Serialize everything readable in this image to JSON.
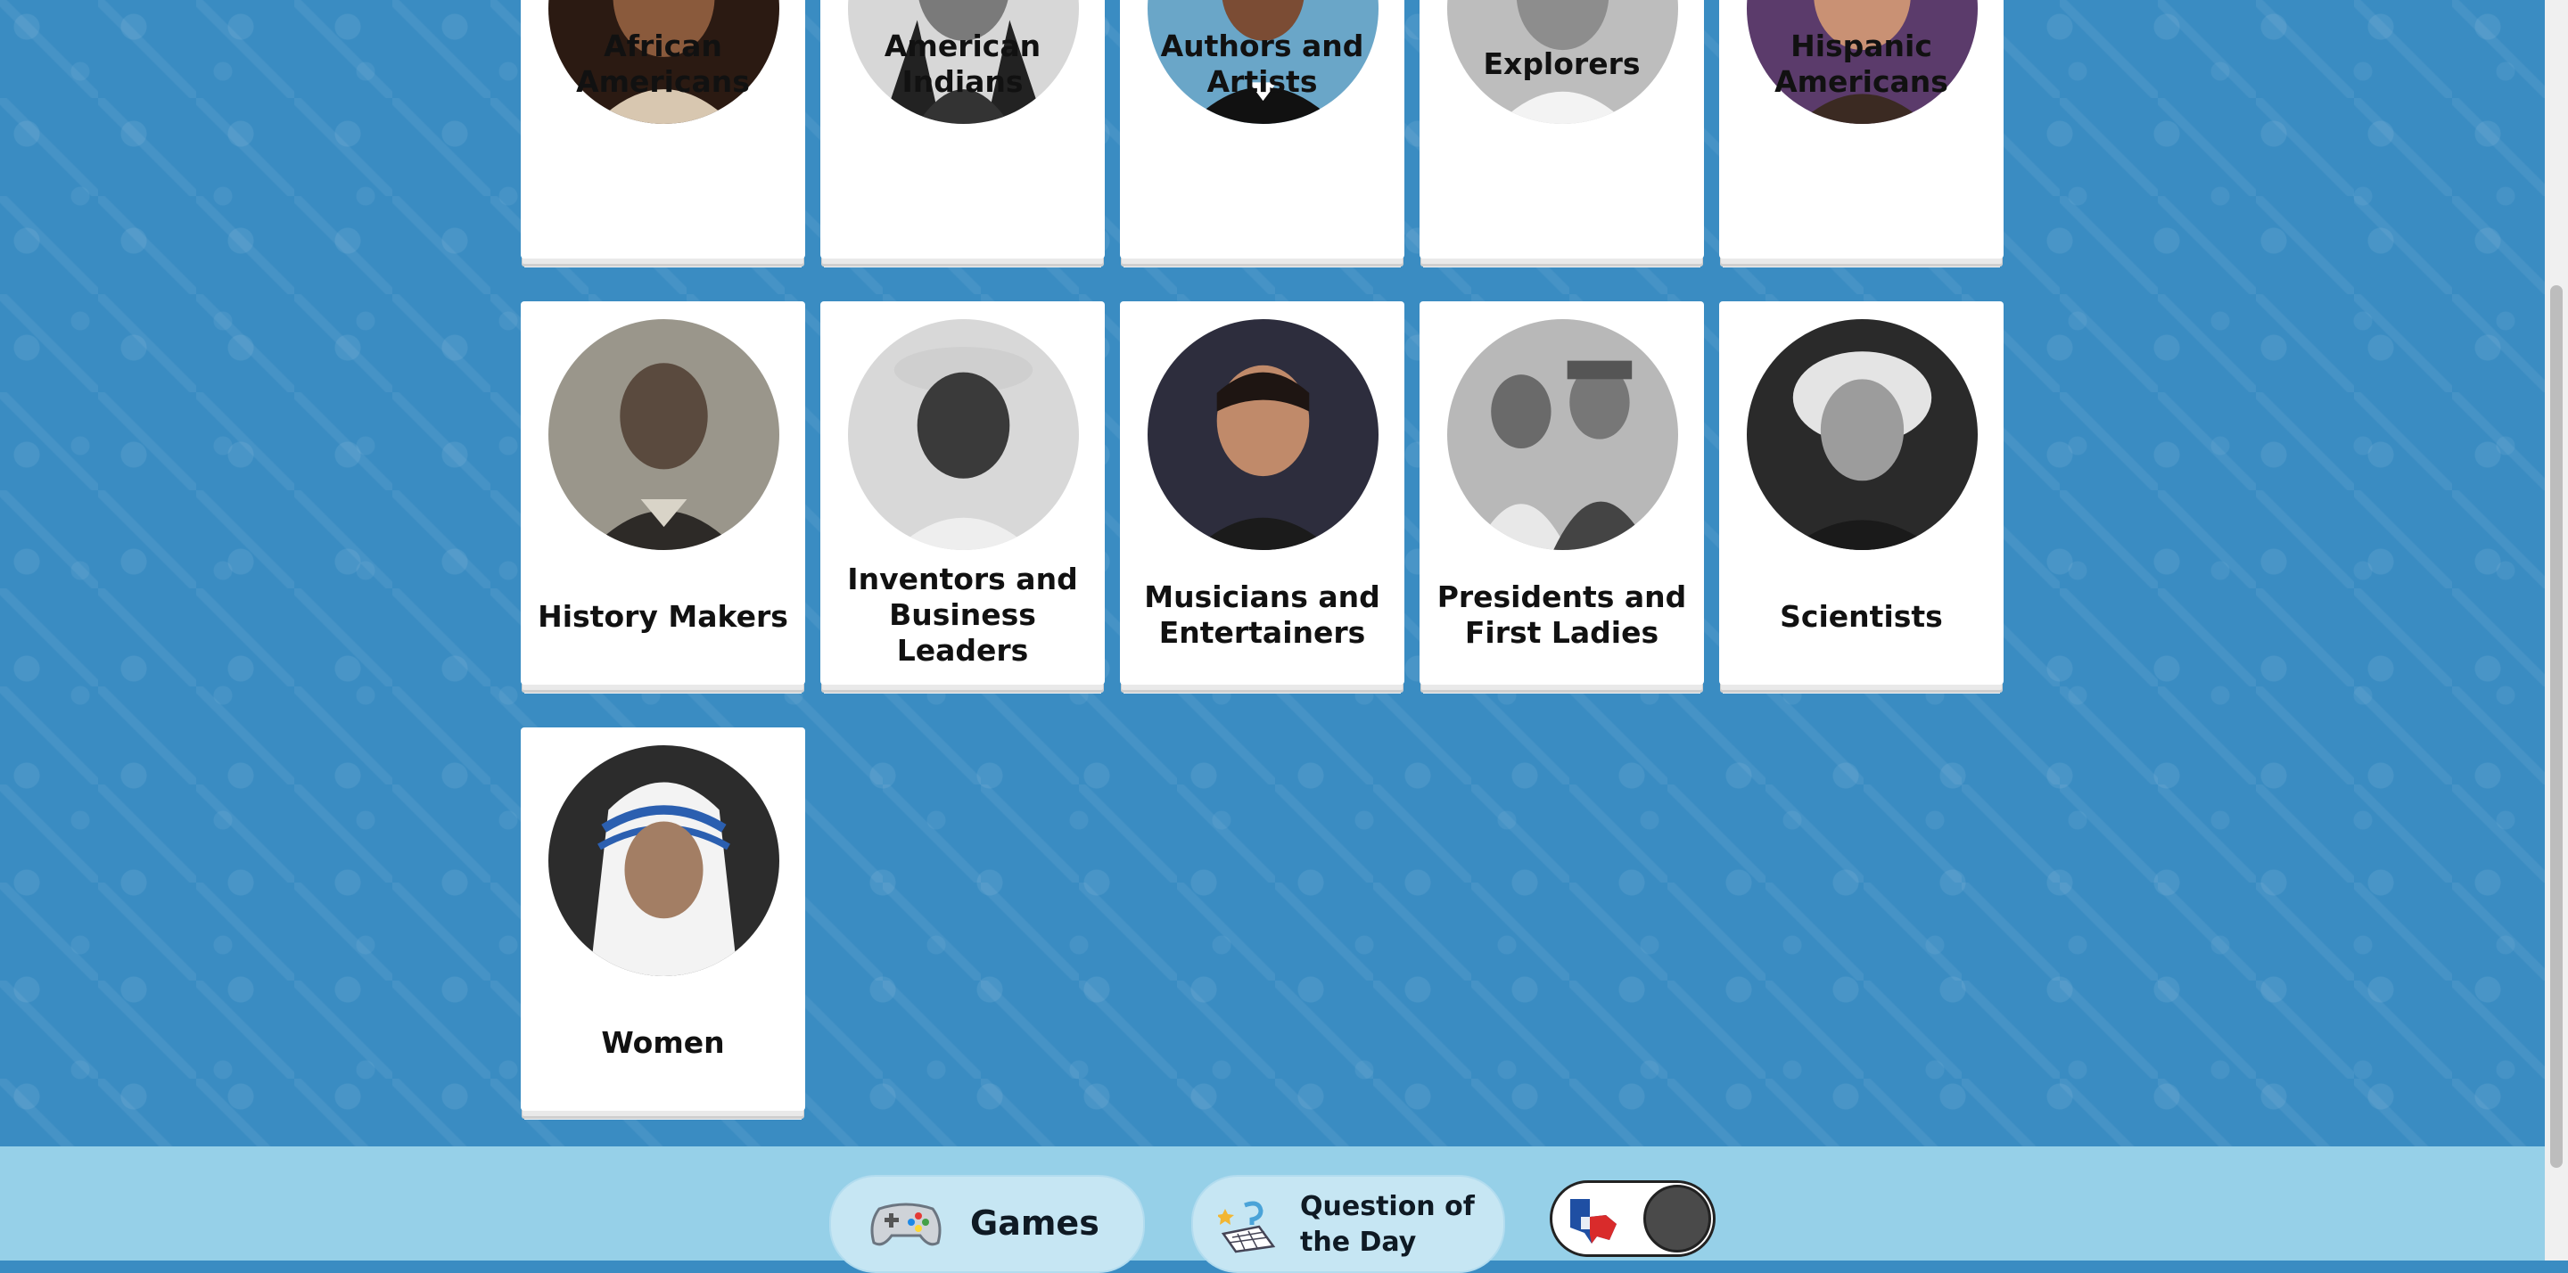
{
  "categories": [
    {
      "label": "African Americans",
      "photo": "woman-portrait-smiling"
    },
    {
      "label": "American Indians",
      "photo": "native-elder-portrait"
    },
    {
      "label": "Authors and Artists",
      "photo": "man-in-tuxedo"
    },
    {
      "label": "Explorers",
      "photo": "smiling-woman-bw"
    },
    {
      "label": "Hispanic Americans",
      "photo": "older-woman-smiling"
    },
    {
      "label": "History Makers",
      "photo": "woman-bw-portrait"
    },
    {
      "label": "Inventors and Business Leaders",
      "photo": "man-in-hat-laughing"
    },
    {
      "label": "Musicians and Entertainers",
      "photo": "man-with-beard"
    },
    {
      "label": "Presidents and First Ladies",
      "photo": "couple-bw-photo"
    },
    {
      "label": "Scientists",
      "photo": "scientist-portrait"
    },
    {
      "label": "Women",
      "photo": "nun-portrait"
    }
  ],
  "footer": {
    "games_label": "Games",
    "qotd_label": "Question of the Day",
    "toggle_icon": "texas-flag-icon"
  },
  "colors": {
    "background": "#3a8cc2",
    "footer": "#96d0e8",
    "card": "#ffffff"
  }
}
